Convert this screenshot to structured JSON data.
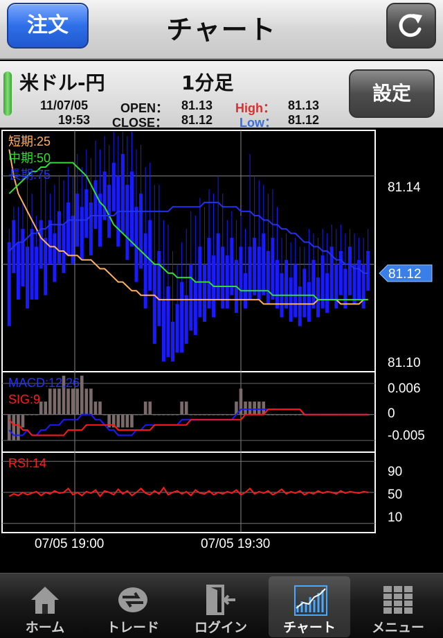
{
  "nav": {
    "title": "チャート",
    "order_label": "注文"
  },
  "info": {
    "pair": "米ドル-円",
    "period": "1分足",
    "date": "11/07/05",
    "time": "19:53",
    "open_label": "OPEN：",
    "open_value": "81.13",
    "close_label": "CLOSE：",
    "close_value": "81.12",
    "high_label": "High：",
    "high_value": "81.13",
    "low_label": "Low：",
    "low_value": "81.12",
    "settings_label": "設定"
  },
  "colors": {
    "up": "#ff1a1a",
    "down": "#1a1aff",
    "short": "#ffb060",
    "mid": "#33dd33",
    "long": "#2233ee",
    "price_tag": "#3a7ee8"
  },
  "chart_data": [
    {
      "type": "candlestick",
      "legend": [
        "短期:25",
        "中期:50",
        "長期:75"
      ],
      "y_ticks": [
        "81.14",
        "81.12",
        "81.10"
      ],
      "current_price": "81.12",
      "x_ticks": [
        "07/05 19:00",
        "07/05 19:30"
      ],
      "ylim": [
        81.096,
        81.15
      ],
      "grid": true,
      "candles": [
        [
          81.125,
          81.128,
          81.112,
          81.106
        ],
        [
          81.13,
          81.133,
          81.126,
          81.118
        ],
        [
          81.125,
          81.133,
          81.118,
          81.112
        ],
        [
          81.128,
          81.134,
          81.12,
          81.115
        ],
        [
          81.124,
          81.14,
          81.119,
          81.11
        ],
        [
          81.128,
          81.136,
          81.12,
          81.112
        ],
        [
          81.124,
          81.131,
          81.119,
          81.112
        ],
        [
          81.13,
          81.14,
          81.124,
          81.119
        ],
        [
          81.126,
          81.141,
          81.12,
          81.113
        ],
        [
          81.13,
          81.136,
          81.124,
          81.12
        ],
        [
          81.127,
          81.138,
          81.122,
          81.116
        ],
        [
          81.132,
          81.14,
          81.126,
          81.12
        ],
        [
          81.129,
          81.139,
          81.124,
          81.118
        ],
        [
          81.134,
          81.142,
          81.127,
          81.122
        ],
        [
          81.131,
          81.14,
          81.125,
          81.12
        ],
        [
          81.136,
          81.145,
          81.129,
          81.124
        ],
        [
          81.133,
          81.142,
          81.127,
          81.121
        ],
        [
          81.137,
          81.146,
          81.132,
          81.126
        ],
        [
          81.134,
          81.144,
          81.128,
          81.122
        ],
        [
          81.139,
          81.148,
          81.133,
          81.128
        ],
        [
          81.136,
          81.146,
          81.13,
          81.124
        ],
        [
          81.141,
          81.149,
          81.135,
          81.13
        ],
        [
          81.138,
          81.147,
          81.131,
          81.126
        ],
        [
          81.143,
          81.15,
          81.135,
          81.132
        ],
        [
          81.14,
          81.149,
          81.128,
          81.124
        ],
        [
          81.145,
          81.15,
          81.131,
          81.127
        ],
        [
          81.138,
          81.149,
          81.126,
          81.121
        ],
        [
          81.141,
          81.15,
          81.129,
          81.124
        ],
        [
          81.133,
          81.146,
          81.12,
          81.116
        ],
        [
          81.136,
          81.147,
          81.124,
          81.119
        ],
        [
          81.127,
          81.142,
          81.116,
          81.11
        ],
        [
          81.13,
          81.143,
          81.119,
          81.114
        ],
        [
          81.12,
          81.138,
          81.108,
          81.102
        ],
        [
          81.123,
          81.138,
          81.11,
          81.106
        ],
        [
          81.112,
          81.13,
          81.1,
          81.098
        ],
        [
          81.115,
          81.129,
          81.102,
          81.099
        ],
        [
          81.107,
          81.123,
          81.1,
          81.098
        ],
        [
          81.111,
          81.12,
          81.103,
          81.1
        ],
        [
          81.116,
          81.125,
          81.106,
          81.1
        ],
        [
          81.113,
          81.128,
          81.105,
          81.102
        ],
        [
          81.12,
          81.132,
          81.11,
          81.105
        ],
        [
          81.116,
          81.131,
          81.108,
          81.104
        ],
        [
          81.124,
          81.135,
          81.114,
          81.108
        ],
        [
          81.12,
          81.133,
          81.112,
          81.107
        ],
        [
          81.126,
          81.137,
          81.116,
          81.11
        ],
        [
          81.122,
          81.136,
          81.113,
          81.108
        ],
        [
          81.127,
          81.14,
          81.117,
          81.112
        ],
        [
          81.124,
          81.136,
          81.115,
          81.11
        ],
        [
          81.122,
          81.13,
          81.114,
          81.11
        ],
        [
          81.126,
          81.132,
          81.118,
          81.113
        ],
        [
          81.121,
          81.13,
          81.114,
          81.109
        ],
        [
          81.124,
          81.131,
          81.117,
          81.112
        ],
        [
          81.118,
          81.128,
          81.114,
          81.11
        ],
        [
          81.124,
          81.145,
          81.118,
          81.112
        ],
        [
          81.126,
          81.14,
          81.118,
          81.113
        ],
        [
          81.124,
          81.139,
          81.117,
          81.112
        ],
        [
          81.127,
          81.138,
          81.119,
          81.113
        ],
        [
          81.123,
          81.136,
          81.117,
          81.111
        ],
        [
          81.126,
          81.137,
          81.118,
          81.112
        ],
        [
          81.121,
          81.133,
          81.115,
          81.11
        ],
        [
          81.118,
          81.126,
          81.112,
          81.108
        ],
        [
          81.121,
          81.127,
          81.114,
          81.11
        ],
        [
          81.117,
          81.125,
          81.111,
          81.107
        ],
        [
          81.12,
          81.126,
          81.113,
          81.108
        ],
        [
          81.115,
          81.124,
          81.111,
          81.106
        ],
        [
          81.119,
          81.124,
          81.112,
          81.108
        ],
        [
          81.116,
          81.128,
          81.111,
          81.107
        ],
        [
          81.121,
          81.127,
          81.114,
          81.11
        ],
        [
          81.117,
          81.126,
          81.112,
          81.108
        ],
        [
          81.122,
          81.128,
          81.115,
          81.11
        ],
        [
          81.118,
          81.127,
          81.113,
          81.109
        ],
        [
          81.124,
          81.129,
          81.117,
          81.112
        ],
        [
          81.12,
          81.128,
          81.114,
          81.11
        ],
        [
          81.123,
          81.129,
          81.118,
          81.113
        ],
        [
          81.119,
          81.127,
          81.114,
          81.11
        ],
        [
          81.124,
          81.128,
          81.118,
          81.113
        ],
        [
          81.12,
          81.127,
          81.115,
          81.111
        ],
        [
          81.121,
          81.126,
          81.116,
          81.112
        ],
        [
          81.12,
          81.126,
          81.113,
          81.11
        ],
        [
          81.123,
          81.128,
          81.118,
          81.114
        ]
      ],
      "ma_short": [
        81.146,
        81.14,
        81.136,
        81.134,
        81.132,
        81.13,
        81.128,
        81.126,
        81.125,
        81.124,
        81.124,
        81.123,
        81.123,
        81.122,
        81.122,
        81.122,
        81.121,
        81.121,
        81.121,
        81.12,
        81.119,
        81.119,
        81.118,
        81.117,
        81.116,
        81.116,
        81.115,
        81.114,
        81.114,
        81.113,
        81.113,
        81.113,
        81.113,
        81.112,
        81.112,
        81.112,
        81.112,
        81.112,
        81.112,
        81.112,
        81.112,
        81.112,
        81.112,
        81.112,
        81.112,
        81.112,
        81.112,
        81.112,
        81.112,
        81.112,
        81.112,
        81.112,
        81.112,
        81.112,
        81.112,
        81.112,
        81.111,
        81.111,
        81.111,
        81.111,
        81.111,
        81.111,
        81.111,
        81.111,
        81.111,
        81.111,
        81.111,
        81.111,
        81.112,
        81.112,
        81.112,
        81.112,
        81.112,
        81.111,
        81.111,
        81.111,
        81.111,
        81.111,
        81.112,
        81.112
      ],
      "ma_mid": [
        81.136,
        81.137,
        81.138,
        81.139,
        81.14,
        81.141,
        81.141,
        81.142,
        81.142,
        81.143,
        81.143,
        81.143,
        81.143,
        81.143,
        81.143,
        81.142,
        81.141,
        81.14,
        81.138,
        81.136,
        81.134,
        81.133,
        81.131,
        81.129,
        81.128,
        81.127,
        81.126,
        81.125,
        81.124,
        81.123,
        81.122,
        81.121,
        81.12,
        81.12,
        81.119,
        81.118,
        81.118,
        81.117,
        81.117,
        81.117,
        81.117,
        81.116,
        81.116,
        81.116,
        81.116,
        81.115,
        81.115,
        81.115,
        81.115,
        81.115,
        81.115,
        81.114,
        81.114,
        81.114,
        81.114,
        81.114,
        81.114,
        81.114,
        81.113,
        81.113,
        81.113,
        81.113,
        81.113,
        81.113,
        81.113,
        81.113,
        81.113,
        81.113,
        81.112,
        81.112,
        81.112,
        81.112,
        81.112,
        81.112,
        81.112,
        81.112,
        81.112,
        81.112,
        81.112,
        81.112
      ],
      "ma_long": [
        81.123,
        81.124,
        81.125,
        81.125,
        81.126,
        81.127,
        81.127,
        81.128,
        81.128,
        81.129,
        81.129,
        81.129,
        81.129,
        81.13,
        81.13,
        81.13,
        81.13,
        81.13,
        81.131,
        81.131,
        81.131,
        81.131,
        81.131,
        81.131,
        81.132,
        81.132,
        81.132,
        81.132,
        81.132,
        81.132,
        81.132,
        81.132,
        81.132,
        81.132,
        81.132,
        81.132,
        81.133,
        81.133,
        81.133,
        81.133,
        81.133,
        81.133,
        81.133,
        81.134,
        81.134,
        81.134,
        81.134,
        81.133,
        81.133,
        81.133,
        81.133,
        81.132,
        81.132,
        81.132,
        81.131,
        81.131,
        81.13,
        81.13,
        81.129,
        81.129,
        81.128,
        81.128,
        81.127,
        81.127,
        81.126,
        81.125,
        81.125,
        81.124,
        81.124,
        81.123,
        81.123,
        81.122,
        81.121,
        81.121,
        81.12,
        81.12,
        81.119,
        81.119,
        81.118,
        81.118
      ]
    },
    {
      "type": "line",
      "legend": [
        "MACD:12,26",
        "SIG:9"
      ],
      "y_ticks": [
        "0.006",
        "0",
        "-0.005"
      ],
      "ylim": [
        -0.007,
        0.008
      ],
      "macd": [
        -0.003,
        -0.004,
        -0.004,
        -0.004,
        -0.003,
        -0.004,
        -0.004,
        -0.003,
        -0.003,
        -0.002,
        -0.002,
        -0.002,
        -0.001,
        -0.001,
        -0.001,
        -0.001,
        0.0,
        0.0,
        0.0,
        -0.001,
        -0.001,
        -0.002,
        -0.003,
        -0.003,
        -0.004,
        -0.004,
        -0.004,
        -0.004,
        -0.003,
        -0.003,
        -0.002,
        -0.002,
        -0.002,
        -0.002,
        -0.002,
        -0.002,
        -0.002,
        -0.002,
        -0.001,
        -0.001,
        -0.001,
        -0.001,
        -0.001,
        -0.001,
        -0.001,
        -0.001,
        -0.001,
        -0.001,
        -0.001,
        -0.001,
        0.0,
        0.001,
        0.001,
        0.001,
        0.001,
        0.001,
        0.001,
        0.001,
        0.001,
        0.001,
        0.001,
        0.001,
        0.001,
        0.001,
        0.001,
        0.0,
        0.0,
        0.0,
        0.0,
        0.0,
        0.0,
        0.0,
        0.0,
        0.0,
        0.0,
        0.0,
        0.0,
        0.0,
        0.0,
        0.0
      ],
      "signal": [
        -0.001,
        -0.002,
        -0.002,
        -0.003,
        -0.003,
        -0.004,
        -0.004,
        -0.004,
        -0.004,
        -0.004,
        -0.004,
        -0.004,
        -0.004,
        -0.003,
        -0.003,
        -0.003,
        -0.003,
        -0.002,
        -0.002,
        -0.002,
        -0.002,
        -0.002,
        -0.002,
        -0.002,
        -0.003,
        -0.003,
        -0.003,
        -0.003,
        -0.003,
        -0.003,
        -0.003,
        -0.003,
        -0.002,
        -0.002,
        -0.002,
        -0.002,
        -0.002,
        -0.002,
        -0.002,
        -0.002,
        -0.001,
        -0.001,
        -0.001,
        -0.001,
        -0.001,
        -0.001,
        -0.001,
        -0.001,
        -0.001,
        -0.001,
        -0.001,
        -0.001,
        0.0,
        0.0,
        0.0,
        0.0,
        0.0,
        0.001,
        0.001,
        0.001,
        0.001,
        0.001,
        0.001,
        0.001,
        0.001,
        0.0,
        0.0,
        0.0,
        0.0,
        0.0,
        0.0,
        0.0,
        0.0,
        0.0,
        0.0,
        0.0,
        0.0,
        0.0,
        0.0,
        0.0
      ]
    },
    {
      "type": "line",
      "legend": [
        "RSI:14"
      ],
      "y_ticks": [
        "90",
        "50",
        "10"
      ],
      "ylim": [
        0,
        100
      ],
      "rsi": [
        45,
        48,
        46,
        50,
        47,
        49,
        51,
        46,
        50,
        48,
        52,
        49,
        50,
        55,
        47,
        50,
        46,
        51,
        49,
        53,
        45,
        52,
        50,
        47,
        54,
        48,
        52,
        46,
        50,
        55,
        49,
        47,
        52,
        48,
        56,
        47,
        50,
        52,
        48,
        51,
        46,
        53,
        49,
        48,
        52,
        47,
        50,
        48,
        51,
        49,
        53,
        47,
        50,
        55,
        48,
        51,
        49,
        52,
        47,
        50,
        54,
        48,
        51,
        49,
        52,
        47,
        50,
        48,
        52,
        49,
        51,
        50,
        48,
        52,
        49,
        51,
        50,
        49,
        51,
        50
      ]
    }
  ],
  "tabs": [
    {
      "label": "ホーム",
      "icon": "home-icon"
    },
    {
      "label": "トレード",
      "icon": "trade-icon"
    },
    {
      "label": "ログイン",
      "icon": "login-icon"
    },
    {
      "label": "チャート",
      "icon": "chart-icon"
    },
    {
      "label": "メニュー",
      "icon": "menu-icon"
    }
  ]
}
